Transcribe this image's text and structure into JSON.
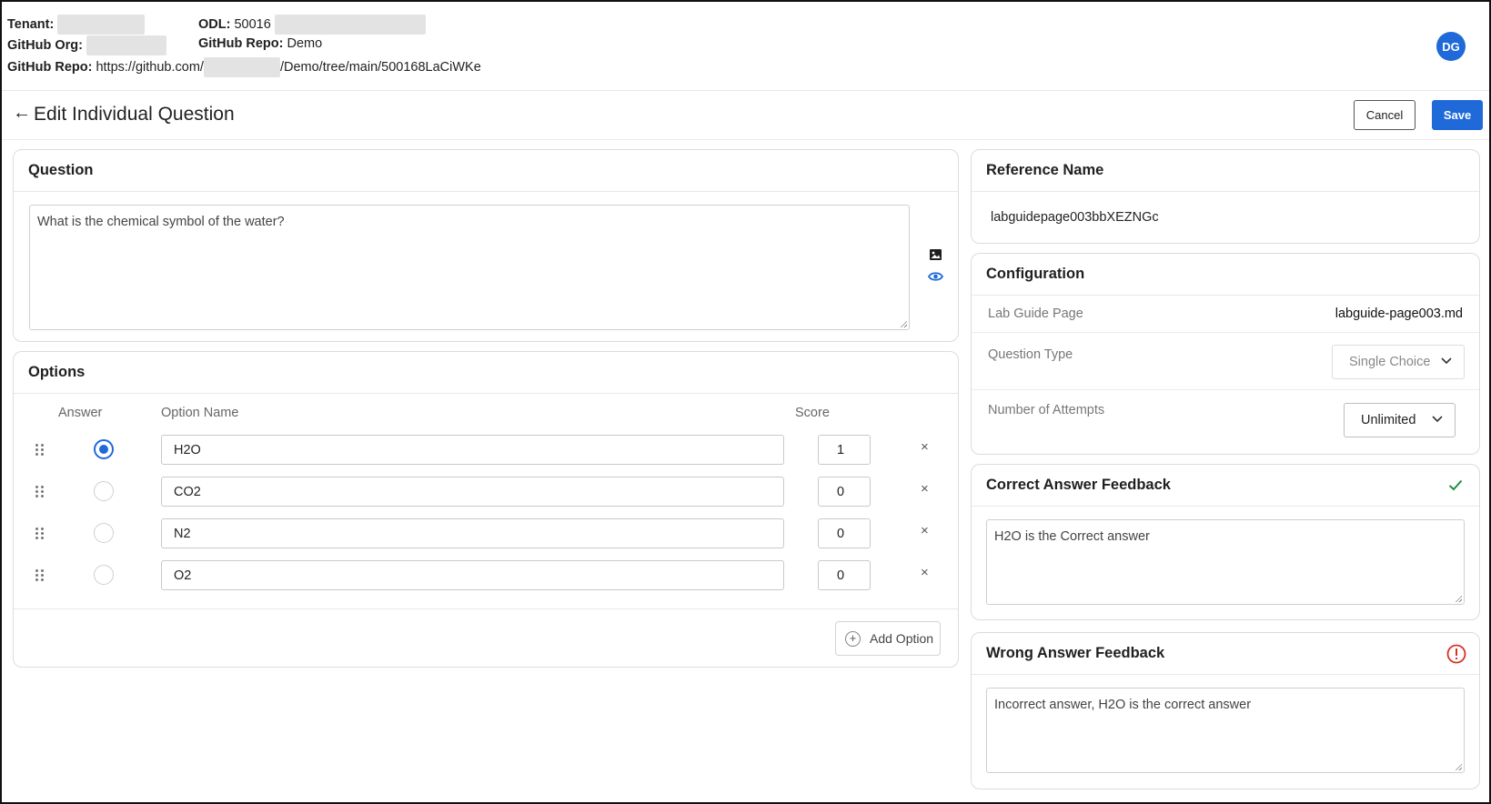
{
  "meta": {
    "tenant_label": "Tenant:",
    "odl_label": "ODL:",
    "odl_value": "50016",
    "github_org_label": "GitHub Org:",
    "github_repo_label": "GitHub Repo:",
    "github_repo_value": "Demo",
    "github_repo_url_label": "GitHub Repo:",
    "github_repo_url_prefix": "https://github.com/",
    "github_repo_url_suffix": "/Demo/tree/main/500168LaCiWKe"
  },
  "user": {
    "initials": "DG"
  },
  "header": {
    "title": "Edit Individual Question",
    "cancel_label": "Cancel",
    "save_label": "Save"
  },
  "question": {
    "heading": "Question",
    "text": "What is the chemical symbol of the water?"
  },
  "options": {
    "heading": "Options",
    "col_answer": "Answer",
    "col_option_name": "Option Name",
    "col_score": "Score",
    "rows": [
      {
        "name": "H2O",
        "score": "1",
        "selected": true
      },
      {
        "name": "CO2",
        "score": "0",
        "selected": false
      },
      {
        "name": "N2",
        "score": "0",
        "selected": false
      },
      {
        "name": "O2",
        "score": "0",
        "selected": false
      }
    ],
    "remove_glyph": "×",
    "add_label": "Add Option",
    "add_glyph": "+"
  },
  "reference": {
    "heading": "Reference Name",
    "value": "labguidepage003bbXEZNGc"
  },
  "configuration": {
    "heading": "Configuration",
    "lab_guide_label": "Lab Guide Page",
    "lab_guide_value": "labguide-page003.md",
    "question_type_label": "Question Type",
    "question_type_value": "Single Choice",
    "attempts_label": "Number of Attempts",
    "attempts_value": "Unlimited"
  },
  "correct_feedback": {
    "heading": "Correct Answer Feedback",
    "text": "H2O is the Correct answer",
    "icon_color": "#1e8e3e"
  },
  "wrong_feedback": {
    "heading": "Wrong Answer Feedback",
    "text": "Incorrect answer, H2O is the correct answer",
    "icon_color": "#d93025"
  },
  "colors": {
    "accent": "#1f6ad8"
  }
}
